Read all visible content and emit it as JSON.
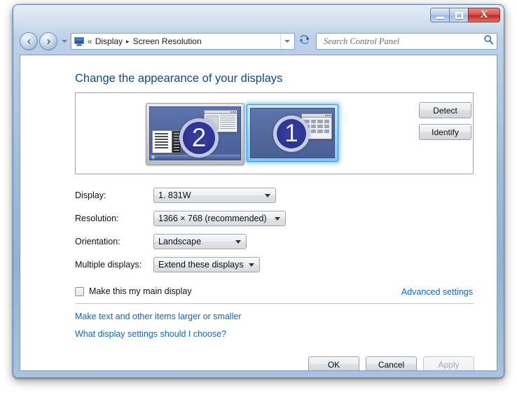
{
  "window": {
    "caption_buttons": [
      {
        "name": "minimize",
        "glyph": "minimize-icon"
      },
      {
        "name": "maximize",
        "glyph": "maximize-icon"
      },
      {
        "name": "close",
        "glyph": "close-icon",
        "label": "X",
        "color": "#c0392b"
      }
    ]
  },
  "navbar": {
    "back_icon": "back-arrow-icon",
    "forward_icon": "forward-arrow-icon",
    "history_dropdown_icon": "chevron-down-icon",
    "address_icon": "display-monitor-icon",
    "breadcrumb_prefix": "«",
    "breadcrumbs": [
      "Display",
      "Screen Resolution"
    ],
    "breadcrumb_separator": "▸",
    "address_chevron_icon": "chevron-down-icon",
    "refresh_icon": "refresh-icon",
    "search": {
      "placeholder": "Search Control Panel",
      "value": "",
      "icon": "search-icon"
    }
  },
  "page": {
    "heading": "Change the appearance of your displays",
    "heading_color": "#15487d"
  },
  "preview": {
    "monitors": [
      {
        "number": "2",
        "name": "monitor-2",
        "selected": false,
        "has_taskbar": true
      },
      {
        "number": "1",
        "name": "monitor-1",
        "selected": true,
        "has_taskbar": false
      }
    ],
    "buttons": [
      {
        "name": "detect-button",
        "label": "Detect",
        "enabled": true
      },
      {
        "name": "identify-button",
        "label": "Identify",
        "enabled": true
      }
    ]
  },
  "form": {
    "display": {
      "label": "Display:",
      "value": "1. 831W",
      "options": [
        "1. 831W"
      ]
    },
    "resolution": {
      "label": "Resolution:",
      "value": "1366 × 768 (recommended)",
      "options": [
        "1366 × 768 (recommended)"
      ]
    },
    "orientation": {
      "label": "Orientation:",
      "value": "Landscape",
      "options": [
        "Landscape"
      ]
    },
    "multiple_displays": {
      "label": "Multiple displays:",
      "value": "Extend these displays",
      "options": [
        "Extend these displays"
      ]
    },
    "main_display_checkbox": {
      "label": "Make this my main display",
      "checked": false
    },
    "advanced_settings_link": "Advanced settings"
  },
  "links": [
    "Make text and other items larger or smaller",
    "What display settings should I choose?"
  ],
  "footer": {
    "buttons": [
      {
        "name": "ok-button",
        "label": "OK",
        "enabled": true
      },
      {
        "name": "cancel-button",
        "label": "Cancel",
        "enabled": true
      },
      {
        "name": "apply-button",
        "label": "Apply",
        "enabled": false
      }
    ]
  },
  "colors": {
    "link": "#1464b4",
    "heading": "#15487d",
    "frame": "#9fbbdc",
    "selection_glow": "#5aafF0"
  }
}
